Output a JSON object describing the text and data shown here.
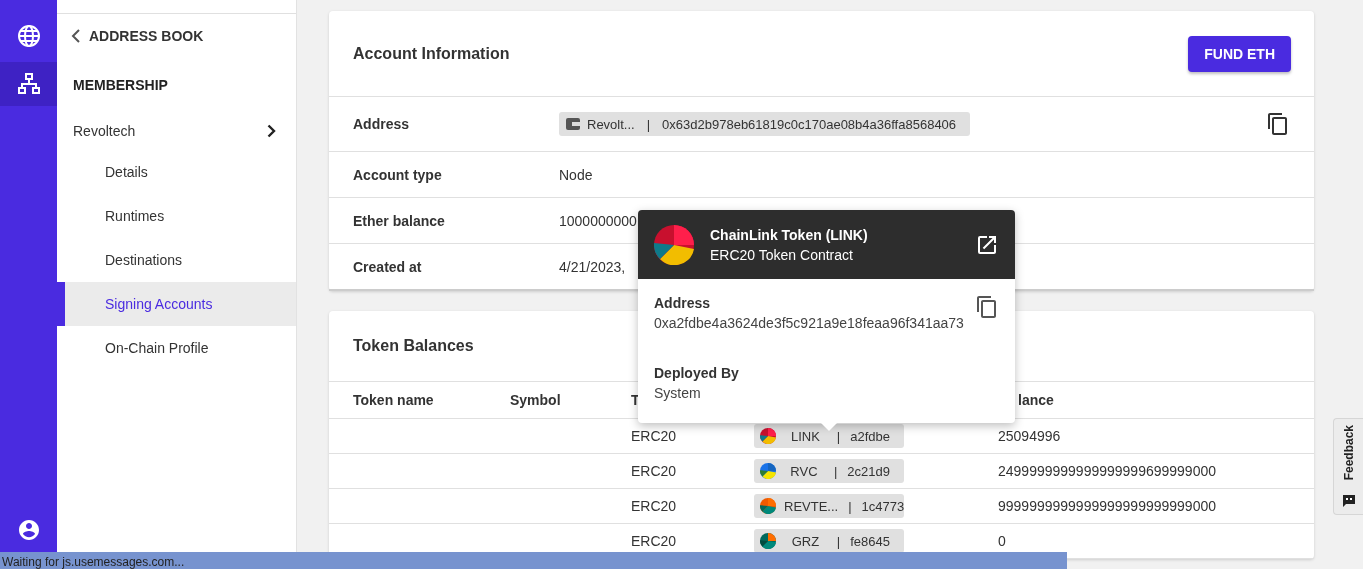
{
  "rail": {
    "items": [
      {
        "kind": "globe",
        "selected": false
      },
      {
        "kind": "network",
        "selected": true
      }
    ],
    "account": {
      "kind": "account"
    }
  },
  "sidebar": {
    "back_link": "ADDRESS BOOK",
    "section": "MEMBERSHIP",
    "group": "Revoltech",
    "items": [
      {
        "label": "Details",
        "selected": false
      },
      {
        "label": "Runtimes",
        "selected": false
      },
      {
        "label": "Destinations",
        "selected": false
      },
      {
        "label": "Signing Accounts",
        "selected": true
      },
      {
        "label": "On-Chain Profile",
        "selected": false
      }
    ]
  },
  "account_card": {
    "title": "Account Information",
    "button": "FUND ETH",
    "rows": [
      {
        "kind": "chip",
        "label": "Address",
        "name": "Revolt...",
        "separator": "|",
        "value": "0x63d2b978eb61819c0c170ae08b4a36ffa8568406"
      },
      {
        "kind": "text",
        "label": "Account type",
        "value": "Node"
      },
      {
        "kind": "text",
        "label": "Ether balance",
        "value": "1000000000"
      },
      {
        "kind": "text",
        "label": "Created at",
        "value": "4/21/2023,"
      }
    ]
  },
  "popup": {
    "title": "ChainLink Token (LINK)",
    "subtitle": "ERC20 Token Contract",
    "address_label": "Address",
    "address": "0xa2fdbe4a3624de3f5c921a9e18feaa96f341aa73",
    "deployed_label": "Deployed By",
    "deployed_by": "System"
  },
  "token_card": {
    "title": "Token Balances",
    "columns": {
      "token_name": "Token name",
      "symbol": "Symbol",
      "column_3": "T",
      "column_5": "lance"
    },
    "rows": [
      {
        "type": "ERC20",
        "symbol": "LINK",
        "separator": "|",
        "short_address": "a2fdbe",
        "balance": "25094996"
      },
      {
        "type": "ERC20",
        "symbol": "RVC",
        "separator": "|",
        "short_address": "2c21d9",
        "balance": "2499999999999999999699999000"
      },
      {
        "type": "ERC20",
        "symbol": "REVTE...",
        "separator": "|",
        "short_address": "1c4773",
        "balance": "9999999999999999999999999000"
      },
      {
        "type": "ERC20",
        "symbol": "GRZ",
        "separator": "|",
        "short_address": "fe8645",
        "balance": "0"
      }
    ]
  },
  "feedback": "Feedback",
  "status_bar": "Waiting for js.usemessages.com..."
}
